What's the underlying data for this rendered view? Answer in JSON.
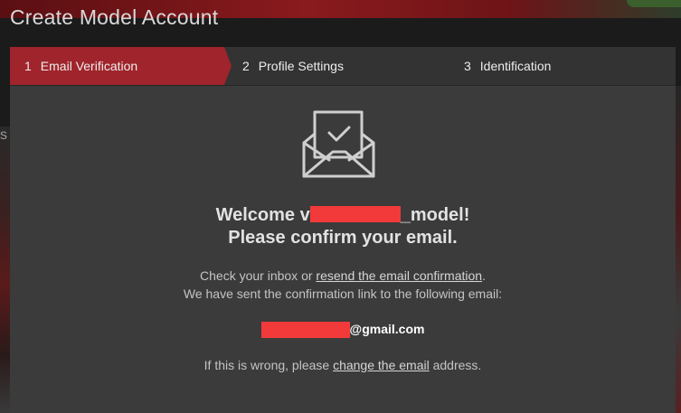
{
  "window": {
    "title": "Create Model Account"
  },
  "steps": [
    {
      "number": "1",
      "label": "Email Verification",
      "active": true
    },
    {
      "number": "2",
      "label": "Profile Settings",
      "active": false
    },
    {
      "number": "3",
      "label": "Identification",
      "active": false
    }
  ],
  "welcome": {
    "prefix": "Welcome ",
    "name_start": "v",
    "name_suffix": "_model!",
    "line2": "Please confirm your email."
  },
  "info": {
    "line1_prefix": "Check your inbox or ",
    "resend_link": "resend the email confirmation",
    "line1_suffix": ".",
    "line2": "We have sent the confirmation link to the following email:"
  },
  "email": {
    "domain": "@gmail.com"
  },
  "bottom": {
    "prefix": "If this is wrong, please ",
    "change_link": "change the email",
    "suffix": " address."
  },
  "icons": {
    "envelope": "envelope-check-icon"
  },
  "colors": {
    "accent": "#a0242c",
    "redaction": "#f23a3a",
    "modal_bg": "#3b3b3b"
  }
}
